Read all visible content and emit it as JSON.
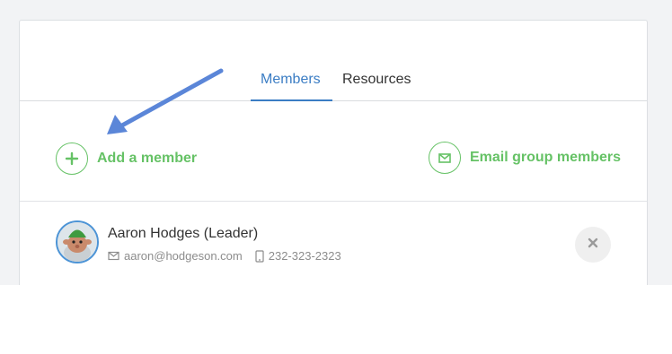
{
  "tabs": [
    {
      "label": "Members",
      "active": true
    },
    {
      "label": "Resources",
      "active": false
    }
  ],
  "actions": {
    "add_member_label": "Add a member",
    "email_group_label": "Email group members"
  },
  "members": [
    {
      "name": "Aaron Hodges (Leader)",
      "email": "aaron@hodgeson.com",
      "phone": "232-323-2323"
    }
  ],
  "icons": {
    "add": "plus-icon",
    "email": "envelope-icon",
    "phone": "phone-icon",
    "remove": "close-icon",
    "annotation": "arrow-icon"
  },
  "colors": {
    "accent_blue": "#3b7dc4",
    "action_green": "#66c266",
    "annotation_arrow": "#5b86d8"
  }
}
